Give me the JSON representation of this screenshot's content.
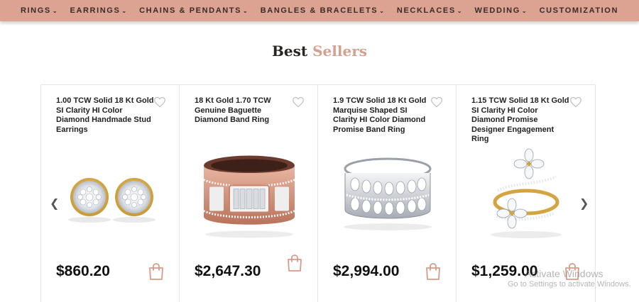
{
  "nav": {
    "items": [
      {
        "label": "RINGS",
        "chevron": true
      },
      {
        "label": "EARRINGS",
        "chevron": true
      },
      {
        "label": "CHAINS & PENDANTS",
        "chevron": true
      },
      {
        "label": "BANGLES & BRACELETS",
        "chevron": true
      },
      {
        "label": "NECKLACES",
        "chevron": true
      },
      {
        "label": "WEDDING",
        "chevron": true
      },
      {
        "label": "CUSTOMIZATION",
        "chevron": false
      }
    ]
  },
  "section": {
    "title_dark": "Best",
    "title_accent": "Sellers"
  },
  "products": [
    {
      "title": "1.00 TCW Solid 18 Kt Gold SI Clarity HI Color Diamond Handmade Stud Earrings",
      "price": "$860.20"
    },
    {
      "title": "18 Kt Gold 1.70 TCW Genuine Baguette Diamond Band Ring",
      "price": "$2,647.30"
    },
    {
      "title": "1.9 TCW Solid 18 Kt Gold Marquise Shaped SI Clarity HI Color Diamond Promise Band Ring",
      "price": "$2,994.00"
    },
    {
      "title": "1.15 TCW Solid 18 Kt Gold SI Clarity HI Color Diamond Promise Designer Engagement Ring",
      "price": "$1,259.00"
    }
  ],
  "watermark": {
    "line1": "Activate Windows",
    "line2": "Go to Settings to activate Windows."
  },
  "colors": {
    "nav_bg": "#dca392",
    "accent": "#d5a08e",
    "icon_accent": "#d99a86"
  },
  "icons": {
    "prev": "chevron-left-icon",
    "next": "chevron-right-icon",
    "wishlist": "heart-outline-icon",
    "cart": "shopping-bag-icon"
  }
}
